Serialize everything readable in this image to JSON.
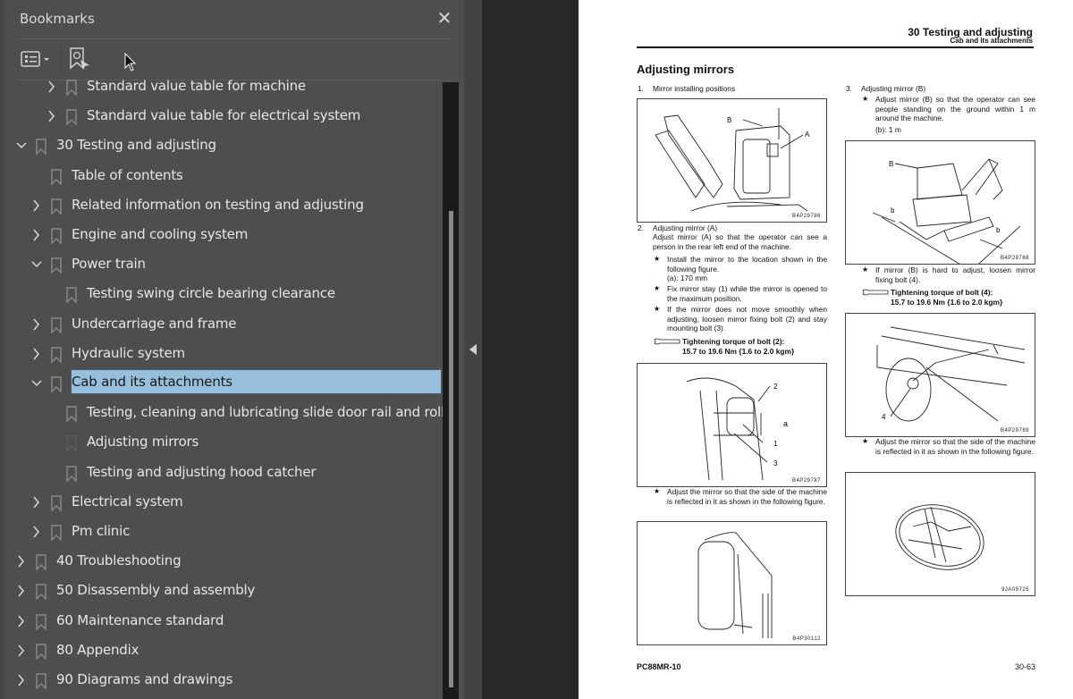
{
  "bookmarks_panel": {
    "title": "Bookmarks",
    "close_label": "✕",
    "toolbar": {
      "options_icon": "list-options-icon",
      "find_bookmark_icon": "find-current-bookmark-icon"
    },
    "items": [
      {
        "label": "Standard value table for machine",
        "level": 2,
        "expandable": true,
        "expanded": false
      },
      {
        "label": "Standard value table for electrical system",
        "level": 2,
        "expandable": true,
        "expanded": false
      },
      {
        "label": "30 Testing and adjusting",
        "level": 0,
        "expandable": true,
        "expanded": true
      },
      {
        "label": "Table of contents",
        "level": 1,
        "expandable": false
      },
      {
        "label": "Related information on testing and adjusting",
        "level": 1,
        "expandable": true,
        "expanded": false
      },
      {
        "label": "Engine and cooling system",
        "level": 1,
        "expandable": true,
        "expanded": false
      },
      {
        "label": "Power train",
        "level": 1,
        "expandable": true,
        "expanded": true
      },
      {
        "label": "Testing swing circle bearing clearance",
        "level": 2,
        "expandable": false
      },
      {
        "label": "Undercarriage and frame",
        "level": 1,
        "expandable": true,
        "expanded": false
      },
      {
        "label": "Hydraulic system",
        "level": 1,
        "expandable": true,
        "expanded": false
      },
      {
        "label": "Cab and its attachments",
        "level": 1,
        "expandable": true,
        "expanded": true,
        "selected": true
      },
      {
        "label": "Testing, cleaning and lubricating slide door rail and roller",
        "level": 2,
        "expandable": false
      },
      {
        "label": "Adjusting mirrors",
        "level": 2,
        "expandable": false,
        "current": true
      },
      {
        "label": "Testing and adjusting hood catcher",
        "level": 2,
        "expandable": false
      },
      {
        "label": "Electrical system",
        "level": 1,
        "expandable": true,
        "expanded": false
      },
      {
        "label": "Pm clinic",
        "level": 1,
        "expandable": true,
        "expanded": false
      },
      {
        "label": "40 Troubleshooting",
        "level": 0,
        "expandable": true,
        "expanded": false
      },
      {
        "label": "50 Disassembly and assembly",
        "level": 0,
        "expandable": true,
        "expanded": false
      },
      {
        "label": "60 Maintenance standard",
        "level": 0,
        "expandable": true,
        "expanded": false
      },
      {
        "label": "80 Appendix",
        "level": 0,
        "expandable": true,
        "expanded": false
      },
      {
        "label": "90 Diagrams and drawings",
        "level": 0,
        "expandable": true,
        "expanded": false
      }
    ],
    "selection_color": "#97bfdc"
  },
  "page": {
    "header_title": "30 Testing and adjusting",
    "header_subtitle": "Cab and its attachments",
    "title": "Adjusting mirrors",
    "step1": {
      "num": "1.",
      "text": "Mirror installing positions",
      "figure_code": "B4P29786",
      "labels": [
        "B",
        "A"
      ]
    },
    "step2": {
      "num": "2.",
      "heading": "Adjusting mirror (A)",
      "intro": "Adjust mirror (A) so that the operator can see a person in the rear left end of the machine.",
      "notes": [
        "Install the mirror to the location shown in the following figure.",
        "Fix mirror stay (1) while the mirror is opened to the maximum position.",
        "If the mirror does not move smoothly when adjusting, loosen mirror fixing bolt (2) and stay mounting bolt (3)."
      ],
      "note1_value": "(a): 170 mm",
      "torque_label": "Tightening torque of bolt (2):",
      "torque_value": "15.7 to 19.6 Nm {1.6 to 2.0 kgm}",
      "figure_code": "B4P29787",
      "labels": [
        "2",
        "a",
        "1",
        "3"
      ],
      "after_note": "Adjust the mirror so that the side of the machine is reflected in it as shown in the following figure.",
      "figure2_code": "B4P30112"
    },
    "step3": {
      "num": "3.",
      "heading": "Adjusting mirror (B)",
      "note": "Adjust mirror (B) so that the operator can see people standing on the ground within 1 m around the machine.",
      "note_value": "(b): 1 m",
      "figure_code": "B4P29788",
      "labels": [
        "B",
        "b",
        "b"
      ],
      "note2": "If mirror (B) is hard to adjust, loosen mirror fixing bolt (4).",
      "torque_label": "Tightening torque of bolt (4):",
      "torque_value": "15.7 to 19.6 Nm {1.6 to 2.0 kgm}",
      "figure2_code": "B4P29789",
      "figure2_label": "4",
      "after_note": "Adjust the mirror so that the side of the machine is reflected in it as shown in the following figure.",
      "figure3_code": "9JA09725"
    },
    "star": "★",
    "footer_model": "PC88MR-10",
    "footer_page": "30-63"
  },
  "splitter": {
    "collapse_icon": "collapse-left-icon"
  }
}
